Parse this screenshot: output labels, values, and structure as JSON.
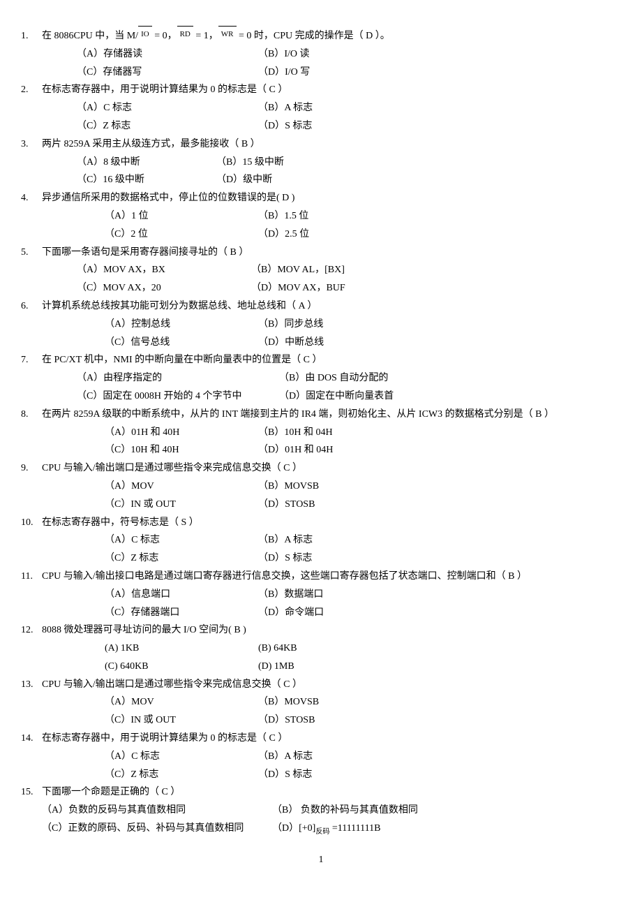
{
  "footer": "1",
  "questions": [
    {
      "num": "1.",
      "pre": "在 8086CPU 中，当 M/",
      "sig1": "IO",
      "mid1": " = 0，",
      "sig2": "RD",
      "mid2": " = 1，",
      "sig3": "WR",
      "post": " = 0 时，CPU 完成的操作是（ D ）。",
      "optsClass": "indent3",
      "rows": [
        {
          "a": "（A）存储器读",
          "b": "（B）I/O 读"
        },
        {
          "a": "（C）存储器写",
          "b": "（D）I/O 写"
        }
      ]
    },
    {
      "num": "2.",
      "text": "在标志寄存器中，用于说明计算结果为 0 的标志是（ C ）",
      "optsClass": "indent3",
      "rows": [
        {
          "a": "（A）C 标志",
          "b": "（B）A 标志"
        },
        {
          "a": "（C）Z 标志",
          "b": "（D）S 标志"
        }
      ]
    },
    {
      "num": "3.",
      "text": "两片 8259A 采用主从级连方式，最多能接收（ B  ）",
      "optsClass": "indent3",
      "rows": [
        {
          "a": "（A）8 级中断",
          "b": "（B）15 级中断"
        },
        {
          "a": "（C）16 级中断",
          "b": "（D）级中断"
        }
      ],
      "colAWidth": "200px"
    },
    {
      "num": "4.",
      "text": "异步通信所采用的数据格式中，停止位的位数错误的是(  D  )",
      "optsClass": "indent2",
      "rows": [
        {
          "a": "（A）1 位",
          "b": "（B）1.5 位"
        },
        {
          "a": "（C）2 位",
          "b": "（D）2.5 位"
        }
      ],
      "colAWidth": "220px"
    },
    {
      "num": "5.",
      "text": "下面哪一条语句是采用寄存器间接寻址的（ B ）",
      "optsClass": "indent3",
      "rows": [
        {
          "a": "（A）MOV  AX，BX",
          "b": "（B）MOV  AL，[BX]"
        },
        {
          "a": "（C）MOV  AX，20",
          "b": "（D）MOV  AX，BUF"
        }
      ],
      "colAWidth": "250px"
    },
    {
      "num": "6.",
      "text": "计算机系统总线按其功能可划分为数据总线、地址总线和（ A  ）",
      "optsClass": "indent2",
      "rows": [
        {
          "a": "（A）控制总线",
          "b": "（B）同步总线"
        },
        {
          "a": "（C）信号总线",
          "b": "（D）中断总线"
        }
      ],
      "colAWidth": "220px"
    },
    {
      "num": "7.",
      "text": "在 PC/XT 机中，NMI 的中断向量在中断向量表中的位置是（  C  ）",
      "optsClass": "indent3",
      "rows": [
        {
          "a": "（A）由程序指定的",
          "b": "（B）由 DOS 自动分配的"
        },
        {
          "a": "（C）固定在 0008H 开始的 4 个字节中",
          "b": "（D）固定在中断向量表首"
        }
      ],
      "colAWidth": "290px"
    },
    {
      "num": "8.",
      "text": "在两片 8259A 级联的中断系统中，从片的 INT 端接到主片的 IR4 端，则初始化主、从片 ICW3 的数据格式分别是（ B  ）",
      "optsClass": "indent2",
      "rows": [
        {
          "a": "（A）01H 和 40H",
          "b": "（B）10H 和 04H"
        },
        {
          "a": "（C）10H 和 40H",
          "b": "（D）01H 和 04H"
        }
      ],
      "colAWidth": "220px"
    },
    {
      "num": "9.",
      "text": "CPU 与输入/输出端口是通过哪些指令来完成信息交换（ C  ）",
      "optsClass": "indent2",
      "rows": [
        {
          "a": "（A）MOV",
          "b": "（B）MOVSB"
        },
        {
          "a": "（C）IN 或 OUT",
          "b": "（D）STOSB"
        }
      ],
      "colAWidth": "220px"
    },
    {
      "num": "10.",
      "text": "在标志寄存器中，符号标志是（ S  ）",
      "optsClass": "indent2",
      "rows": [
        {
          "a": "（A）C 标志",
          "b": "（B）A 标志"
        },
        {
          "a": "（C）Z 标志",
          "b": "（D）S 标志"
        }
      ],
      "colAWidth": "220px"
    },
    {
      "num": "11.",
      "text": "CPU 与输入/输出接口电路是通过端口寄存器进行信息交换，这些端口寄存器包括了状态端口、控制端口和（ B  ）",
      "optsClass": "indent2",
      "rows": [
        {
          "a": "（A）信息端口",
          "b": "（B）数据端口"
        },
        {
          "a": "（C）存储器端口",
          "b": "（D）命令端口"
        }
      ],
      "colAWidth": "220px"
    },
    {
      "num": "12.",
      "text": "8088 微处理器可寻址访问的最大 I/O 空间为( B  )",
      "optsClass": "indent2",
      "rows": [
        {
          "a": "(A) 1KB",
          "b": "(B) 64KB"
        },
        {
          "a": "(C) 640KB",
          "b": "(D) 1MB"
        }
      ],
      "colAWidth": "220px"
    },
    {
      "num": "13.",
      "text": "CPU 与输入/输出端口是通过哪些指令来完成信息交换（ C  ）",
      "optsClass": "indent2",
      "rows": [
        {
          "a": "（A）MOV",
          "b": "（B）MOVSB"
        },
        {
          "a": "（C）IN 或 OUT",
          "b": "（D）STOSB"
        }
      ],
      "colAWidth": "220px"
    },
    {
      "num": "14.",
      "text": "在标志寄存器中，用于说明计算结果为 0 的标志是（ C  ）",
      "optsClass": "indent2",
      "rows": [
        {
          "a": "（A）C 标志",
          "b": "（B）A 标志"
        },
        {
          "a": "（C）Z 标志",
          "b": "（D）S 标志"
        }
      ],
      "colAWidth": "220px"
    },
    {
      "num": "15.",
      "text": "下面哪一个命题是正确的（ C ）",
      "optsClass": "",
      "rows": [
        {
          "a": "（A）负数的反码与其真值数相同",
          "b": "（B） 负数的补码与其真值数相同"
        },
        {
          "a": "（C）正数的原码、反码、补码与其真值数相同",
          "b_pre": "（D）[+0]",
          "b_sub": "反码",
          "b_post": " =11111111B"
        }
      ],
      "colAWidth": "330px",
      "noIndent": true
    }
  ]
}
